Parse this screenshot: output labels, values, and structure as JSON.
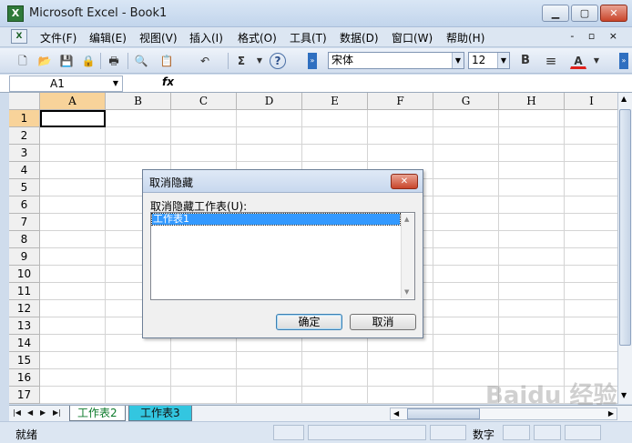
{
  "window": {
    "title": "Microsoft Excel - Book1",
    "app_icon": "X",
    "minimize": "▁",
    "maximize": "▢",
    "close": "✕"
  },
  "menu": {
    "icon": "X",
    "items": [
      {
        "label": "文件(F)"
      },
      {
        "label": "编辑(E)"
      },
      {
        "label": "视图(V)"
      },
      {
        "label": "插入(I)"
      },
      {
        "label": "格式(O)"
      },
      {
        "label": "工具(T)"
      },
      {
        "label": "数据(D)"
      },
      {
        "label": "窗口(W)"
      },
      {
        "label": "帮助(H)"
      }
    ],
    "mdi": "- ▫ ×"
  },
  "toolbar": {
    "font_name": "宋体",
    "font_size": "12",
    "bold": "B",
    "align": "≡",
    "font_color_letter": "A",
    "font_color": "#e0201b",
    "sum": "Σ",
    "help": "?"
  },
  "formula_bar": {
    "name_box": "A1",
    "fx": "fx",
    "value": ""
  },
  "sheet": {
    "columns": [
      "A",
      "B",
      "C",
      "D",
      "E",
      "F",
      "G",
      "H",
      "I"
    ],
    "rows": [
      "1",
      "2",
      "3",
      "4",
      "5",
      "6",
      "7",
      "8",
      "9",
      "10",
      "11",
      "12",
      "13",
      "14",
      "15",
      "16",
      "17"
    ],
    "active_cell": "A1"
  },
  "tabs": {
    "nav": [
      "|◀",
      "◀",
      "▶",
      "▶|"
    ],
    "sheets": [
      "工作表2",
      "工作表3"
    ]
  },
  "status": {
    "ready": "就绪",
    "num": "数字"
  },
  "dialog": {
    "title": "取消隐藏",
    "close": "✕",
    "label": "取消隐藏工作表(U):",
    "items": [
      "工作表1"
    ],
    "ok": "确定",
    "cancel": "取消"
  },
  "watermark": "Baidu 经验"
}
